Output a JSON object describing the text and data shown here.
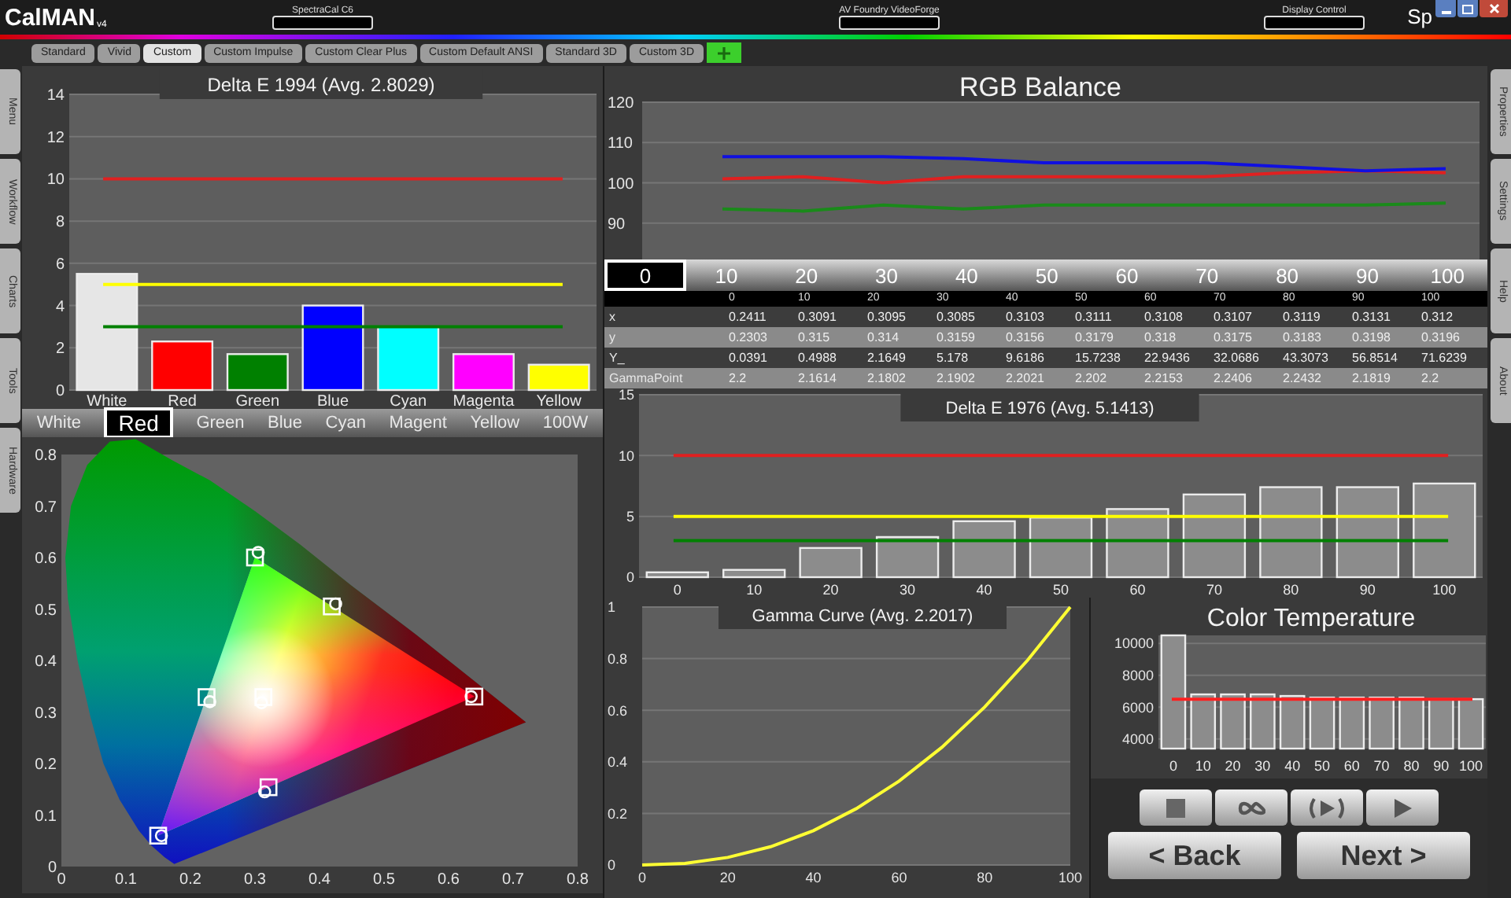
{
  "app": {
    "logo": "CalMAN",
    "version": "v4",
    "devices": [
      "SpectraCal C6",
      "AV Foundry VideoForge",
      "Display Control"
    ],
    "cut_title": "Sp"
  },
  "profile_tabs": [
    {
      "label": "Standard",
      "selected": false
    },
    {
      "label": "Vivid",
      "selected": false
    },
    {
      "label": "Custom",
      "selected": true
    },
    {
      "label": "Custom Impulse",
      "selected": false
    },
    {
      "label": "Custom Clear Plus",
      "selected": false
    },
    {
      "label": "Custom Default ANSI",
      "selected": false
    },
    {
      "label": "Standard 3D",
      "selected": false
    },
    {
      "label": "Custom 3D",
      "selected": false
    }
  ],
  "left_tabs": [
    "Menu",
    "Workflow",
    "Charts",
    "Tools",
    "Hardware"
  ],
  "right_tabs": [
    "Properties",
    "Settings",
    "Help",
    "About"
  ],
  "delta_e_1994": {
    "chart_data": {
      "type": "bar",
      "title": "Delta E 1994 (Avg. 2.8029)",
      "categories": [
        "White",
        "Red",
        "Green",
        "Blue",
        "Cyan",
        "Magenta",
        "Yellow"
      ],
      "values": [
        5.5,
        2.3,
        1.7,
        4.0,
        3.0,
        1.7,
        1.2
      ],
      "colors": [
        "#e6e6e6",
        "#ff0000",
        "#008000",
        "#0000ff",
        "#00ffff",
        "#ff00ff",
        "#ffff00"
      ],
      "ylim": [
        0,
        14
      ],
      "yticks": [
        0,
        2,
        4,
        6,
        8,
        10,
        12,
        14
      ],
      "grid": true,
      "ref_lines": [
        {
          "axis": "y",
          "value": 10,
          "color": "#e02020"
        },
        {
          "axis": "y",
          "value": 5,
          "color": "#ffff00"
        },
        {
          "axis": "y",
          "value": 3,
          "color": "#008000"
        }
      ]
    }
  },
  "color_selector": [
    {
      "label": "White",
      "selected": false
    },
    {
      "label": "Red",
      "selected": true
    },
    {
      "label": "Green",
      "selected": false
    },
    {
      "label": "Blue",
      "selected": false
    },
    {
      "label": "Cyan",
      "selected": false
    },
    {
      "label": "Magent",
      "selected": false
    },
    {
      "label": "Yellow",
      "selected": false
    },
    {
      "label": "100W",
      "selected": false
    }
  ],
  "cie": {
    "chart_data": {
      "type": "scatter",
      "xlim": [
        0,
        0.8
      ],
      "ylim": [
        0,
        0.8
      ],
      "xticks": [
        0,
        0.1,
        0.2,
        0.3,
        0.4,
        0.5,
        0.6,
        0.7,
        0.8
      ],
      "yticks": [
        0,
        0.1,
        0.2,
        0.3,
        0.4,
        0.5,
        0.6,
        0.7,
        0.8
      ],
      "series": [
        {
          "color": "#ffffff",
          "x": [
            0.64,
            0.3,
            0.15,
            0.225,
            0.321,
            0.419,
            0.313
          ],
          "values": [
            0.33,
            0.6,
            0.06,
            0.329,
            0.154,
            0.505,
            0.329
          ]
        },
        {
          "color": "#ffffff",
          "x": [
            0.635,
            0.305,
            0.155,
            0.23,
            0.315,
            0.425,
            0.31
          ],
          "values": [
            0.33,
            0.61,
            0.06,
            0.32,
            0.145,
            0.51,
            0.318
          ]
        }
      ]
    }
  },
  "rgb_balance": {
    "chart_data": {
      "type": "line",
      "title": "RGB Balance",
      "categories": [
        null,
        null,
        null,
        null,
        null,
        null,
        null,
        null,
        null,
        null,
        null
      ],
      "ylim": [
        81,
        120
      ],
      "yticks": [
        90,
        100,
        110,
        120
      ],
      "grid": true,
      "series": [
        {
          "color": "#e02020",
          "values": [
            null,
            101,
            101.5,
            100,
            101.5,
            101.5,
            101.5,
            101.5,
            102.5,
            103,
            102.5
          ]
        },
        {
          "color": "#1a8a1a",
          "values": [
            null,
            93.5,
            93,
            94.5,
            93.5,
            94.5,
            94.5,
            94.5,
            94.5,
            94.5,
            95
          ]
        },
        {
          "color": "#1010e0",
          "values": [
            null,
            106.5,
            106.5,
            106.5,
            106,
            105,
            105,
            105,
            104,
            103,
            103.5
          ]
        }
      ]
    }
  },
  "steps": [
    {
      "label": "0",
      "selected": true
    },
    {
      "label": "10",
      "selected": false
    },
    {
      "label": "20",
      "selected": false
    },
    {
      "label": "30",
      "selected": false
    },
    {
      "label": "40",
      "selected": false
    },
    {
      "label": "50",
      "selected": false
    },
    {
      "label": "60",
      "selected": false
    },
    {
      "label": "70",
      "selected": false
    },
    {
      "label": "80",
      "selected": false
    },
    {
      "label": "90",
      "selected": false
    },
    {
      "label": "100",
      "selected": false
    }
  ],
  "readings": {
    "columns": [
      "0",
      "10",
      "20",
      "30",
      "40",
      "50",
      "60",
      "70",
      "80",
      "90",
      "100"
    ],
    "rows": [
      {
        "label": "x",
        "values": [
          "0.2411",
          "0.3091",
          "0.3095",
          "0.3085",
          "0.3103",
          "0.3111",
          "0.3108",
          "0.3107",
          "0.3119",
          "0.3131",
          "0.312"
        ]
      },
      {
        "label": "y",
        "values": [
          "0.2303",
          "0.315",
          "0.314",
          "0.3159",
          "0.3156",
          "0.3179",
          "0.318",
          "0.3175",
          "0.3183",
          "0.3198",
          "0.3196"
        ]
      },
      {
        "label": "Y_",
        "values": [
          "0.0391",
          "0.4988",
          "2.1649",
          "5.178",
          "9.6186",
          "15.7238",
          "22.9436",
          "32.0686",
          "43.3073",
          "56.8514",
          "71.6239"
        ]
      },
      {
        "label": "GammaPoint",
        "values": [
          "2.2",
          "2.1614",
          "2.1802",
          "2.1902",
          "2.2021",
          "2.202",
          "2.2153",
          "2.2406",
          "2.2432",
          "2.1819",
          "2.2"
        ]
      }
    ]
  },
  "delta_e_1976": {
    "chart_data": {
      "type": "bar",
      "title": "Delta E 1976 (Avg. 5.1413)",
      "categories": [
        "0",
        "10",
        "20",
        "30",
        "40",
        "50",
        "60",
        "70",
        "80",
        "90",
        "100"
      ],
      "values": [
        0.4,
        0.6,
        2.4,
        3.3,
        4.6,
        4.9,
        5.6,
        6.8,
        7.4,
        7.4,
        7.7
      ],
      "ylim": [
        0,
        15
      ],
      "yticks": [
        0,
        5,
        10,
        15
      ],
      "grid": true,
      "ref_lines": [
        {
          "axis": "y",
          "value": 10,
          "color": "#e02020"
        },
        {
          "axis": "y",
          "value": 5,
          "color": "#ffff00"
        },
        {
          "axis": "y",
          "value": 3,
          "color": "#008000"
        }
      ]
    }
  },
  "gamma": {
    "chart_data": {
      "type": "line",
      "title": "Gamma Curve (Avg. 2.2017)",
      "x": [
        0,
        10,
        20,
        30,
        40,
        50,
        60,
        70,
        80,
        90,
        100
      ],
      "xlim": [
        0,
        100
      ],
      "ylim": [
        0,
        1
      ],
      "xticks": [
        0,
        20,
        40,
        60,
        80,
        100
      ],
      "yticks": [
        0,
        0.2,
        0.4,
        0.6,
        0.8,
        1
      ],
      "grid": true,
      "series": [
        {
          "color": "#ffff33",
          "values": [
            0,
            0.006,
            0.029,
            0.071,
            0.133,
            0.218,
            0.325,
            0.456,
            0.612,
            0.793,
            1
          ]
        }
      ]
    }
  },
  "color_temperature": {
    "chart_data": {
      "type": "bar",
      "title": "Color Temperature",
      "categories": [
        "0",
        "10",
        "20",
        "30",
        "40",
        "50",
        "60",
        "70",
        "80",
        "90",
        "100"
      ],
      "values": [
        10500,
        6800,
        6800,
        6800,
        6700,
        6600,
        6600,
        6600,
        6600,
        6500,
        6500
      ],
      "ylim": [
        3400,
        10500
      ],
      "yticks": [
        4000,
        6000,
        8000,
        10000
      ],
      "grid": true,
      "ref_lines": [
        {
          "axis": "y",
          "value": 6500,
          "color": "#ff2020"
        }
      ]
    }
  },
  "controls": {
    "back": "< Back",
    "next": "Next >"
  }
}
